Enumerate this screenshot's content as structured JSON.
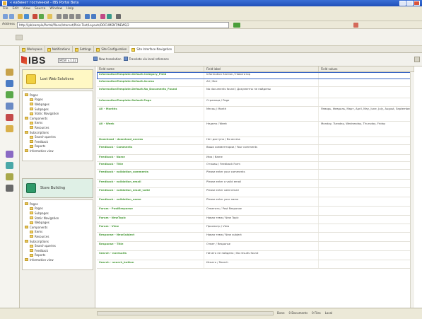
{
  "window": {
    "title": "« кабинет гостинной - IBS Portal Beta"
  },
  "menu": [
    "File",
    "Edit",
    "View",
    "Source",
    "Window",
    "Help"
  ],
  "address": {
    "label": "Address",
    "url": "http://ipb/sample/Portal/Place/Internet/Plain Text/Layouts/DOCUMENT/NEWS/2"
  },
  "tabs": [
    {
      "label": "Workspace"
    },
    {
      "label": "Notifications"
    },
    {
      "label": "Settings"
    },
    {
      "label": "Site Configuration"
    },
    {
      "label": "Site Interface Navigation",
      "active": true
    }
  ],
  "ibs": {
    "logo_text": "IBS",
    "version": "MOVI v.1.22",
    "actions": [
      "New translation",
      "Translate via local reference"
    ]
  },
  "sidebar": {
    "sections": [
      {
        "title": "Lost Web Solutions",
        "items": [
          {
            "label": "Pages",
            "level": 0
          },
          {
            "label": "Pages",
            "level": 1
          },
          {
            "label": "Webpages",
            "level": 1
          },
          {
            "label": "Subpages",
            "level": 1
          },
          {
            "label": "Static Navigation",
            "level": 1
          },
          {
            "label": "Components",
            "level": 0
          },
          {
            "label": "Items",
            "level": 1
          },
          {
            "label": "Resources",
            "level": 1
          },
          {
            "label": "Subscriptions",
            "level": 0
          },
          {
            "label": "Search queries",
            "level": 1
          },
          {
            "label": "Feedback",
            "level": 1
          },
          {
            "label": "Reports",
            "level": 1
          },
          {
            "label": "Information view",
            "level": 0
          }
        ]
      },
      {
        "title": "Store Building",
        "items": [
          {
            "label": "Pages",
            "level": 0
          },
          {
            "label": "Pages",
            "level": 1
          },
          {
            "label": "Subpages",
            "level": 1
          },
          {
            "label": "Static Navigation",
            "level": 1
          },
          {
            "label": "Webpages",
            "level": 1
          },
          {
            "label": "Components",
            "level": 0
          },
          {
            "label": "Items",
            "level": 1
          },
          {
            "label": "Resources",
            "level": 1
          },
          {
            "label": "Subscriptions",
            "level": 0
          },
          {
            "label": "Search queries",
            "level": 1
          },
          {
            "label": "Feedback",
            "level": 1
          },
          {
            "label": "Reports",
            "level": 1
          },
          {
            "label": "Information view",
            "level": 0
          }
        ]
      }
    ]
  },
  "grid": {
    "columns": [
      "Field name",
      "Field label",
      "Field values"
    ],
    "rows": [
      {
        "name": "InformationTemplate.Default.Category_Field",
        "label": "Information Section / Навигатор",
        "values": "",
        "selected": true
      },
      {
        "name": "InformationTemplate.Default.Access",
        "label": "All / Все",
        "values": ""
      },
      {
        "name": "InformationTemplate.Default.No_Documents_Found",
        "label": "No documents found / Документы не найдены",
        "values": ""
      },
      {
        "name": "InformationTemplate.Default.Page",
        "label": "Страница / Page",
        "values": ""
      },
      {
        "name": "All - Months",
        "label": "Месяц / Month",
        "values": "Январь, Февраль, Март, April, May, June, July, August, September"
      },
      {
        "name": "All - Week",
        "label": "Неделя / Week",
        "values": "Monday, Tuesday, Wednesday, Thursday, Friday"
      },
      {
        "name": "Download - download_access",
        "label": "Нет доступа / No access",
        "values": ""
      },
      {
        "name": "Feedback - Comments",
        "label": "Ваши комментарии / Your comments",
        "values": ""
      },
      {
        "name": "Feedback - Name",
        "label": "Имя / Name",
        "values": ""
      },
      {
        "name": "Feedback - Title",
        "label": "Отзывы / Feedback Form",
        "values": ""
      },
      {
        "name": "Feedback - validation_comments",
        "label": "Please enter your comments",
        "values": ""
      },
      {
        "name": "Feedback - validation_email",
        "label": "Please enter a valid email",
        "values": ""
      },
      {
        "name": "Feedback - validation_email_valid",
        "label": "Please enter valid email",
        "values": ""
      },
      {
        "name": "Feedback - validation_name",
        "label": "Please enter your name",
        "values": ""
      },
      {
        "name": "Forum - PostResponse",
        "label": "Ответить / Post Response",
        "values": ""
      },
      {
        "name": "Forum - NewTopic",
        "label": "Новая тема / New Topic",
        "values": ""
      },
      {
        "name": "Forum - View",
        "label": "Просмотр / View",
        "values": ""
      },
      {
        "name": "Response - NewSubject",
        "label": "Новая тема / New subject",
        "values": ""
      },
      {
        "name": "Response - Title",
        "label": "Ответ / Response",
        "values": ""
      },
      {
        "name": "Search - noresults",
        "label": "Ничего не найдено / No results found",
        "values": ""
      },
      {
        "name": "Search - search_button",
        "label": "Искать / Search",
        "values": ""
      }
    ]
  },
  "status": [
    "Done",
    "0 Documents",
    "0 Files",
    "Local"
  ]
}
